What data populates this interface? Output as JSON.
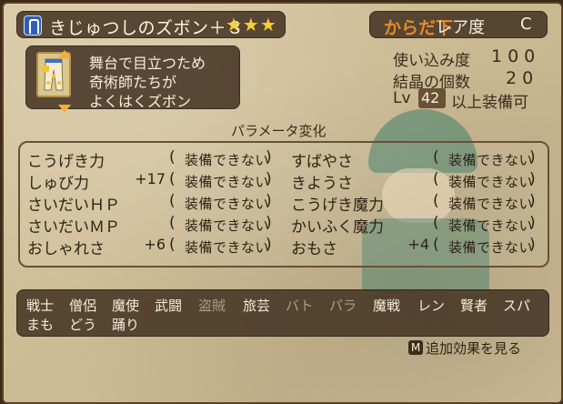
{
  "header": {
    "item_name": "きじゅつしのズボン＋３",
    "stars": "★★★",
    "slot": "からだ下",
    "rarity_label": "レア度",
    "rarity_value": "C"
  },
  "description": {
    "line1": "舞台で目立つため",
    "line2": "奇術師たちが",
    "line3": "よくはくズボン"
  },
  "stats": {
    "usage_label": "使い込み度",
    "usage_value": "100",
    "crystal_label": "結晶の個数",
    "crystal_value": "20",
    "lv_label": "Lv",
    "lv_value": "42",
    "lv_suffix": "以上装備可"
  },
  "params": {
    "title": "パラメータ変化",
    "cannot_equip": "装備できない",
    "left": [
      {
        "label": "こうげき力",
        "value": ""
      },
      {
        "label": "しゅび力",
        "value": "+17"
      },
      {
        "label": "さいだいＨＰ",
        "value": ""
      },
      {
        "label": "さいだいＭＰ",
        "value": ""
      },
      {
        "label": "おしゃれさ",
        "value": "+6"
      }
    ],
    "right": [
      {
        "label": "すばやさ",
        "value": ""
      },
      {
        "label": "きようさ",
        "value": ""
      },
      {
        "label": "こうげき魔力",
        "value": ""
      },
      {
        "label": "かいふく魔力",
        "value": ""
      },
      {
        "label": "おもさ",
        "value": "+4"
      }
    ]
  },
  "jobs": {
    "row1": [
      {
        "label": "戦士",
        "active": true
      },
      {
        "label": "僧侶",
        "active": true
      },
      {
        "label": "魔使",
        "active": true
      },
      {
        "label": "武闘",
        "active": true
      },
      {
        "label": "盗賊",
        "active": false
      },
      {
        "label": "旅芸",
        "active": true
      },
      {
        "label": "バト",
        "active": false
      },
      {
        "label": "パラ",
        "active": false
      },
      {
        "label": "魔戦",
        "active": true
      },
      {
        "label": "レン",
        "active": true
      },
      {
        "label": "賢者",
        "active": true
      },
      {
        "label": "スパ",
        "active": true
      }
    ],
    "row2": [
      {
        "label": "まも",
        "active": true
      },
      {
        "label": "どう",
        "active": true
      },
      {
        "label": "踊り",
        "active": true
      }
    ]
  },
  "footer": {
    "button_key": "M",
    "more_label": "追加効果を見る"
  },
  "colors": {
    "parchment": "#cdbb93",
    "dark_panel": "#46342380",
    "slot_orange": "#e48a2e",
    "star_yellow": "#f3d23a"
  },
  "icons": [
    "lower-body-slot-icon",
    "pants-item-icon",
    "lock-icon",
    "scroll-up-icon",
    "scroll-down-icon",
    "m-button-icon"
  ]
}
